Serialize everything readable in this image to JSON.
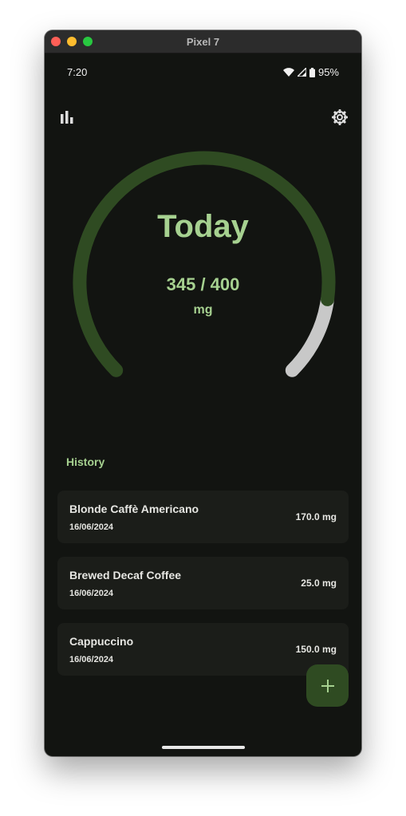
{
  "window": {
    "title": "Pixel 7"
  },
  "status_bar": {
    "time": "7:20",
    "battery": "95%"
  },
  "icons": {
    "stats": "bar-chart-icon",
    "settings": "gear-icon",
    "add": "plus-icon"
  },
  "gauge": {
    "title": "Today",
    "amount_text": "345 / 400",
    "unit": "mg",
    "consumed": 345,
    "limit": 400,
    "colors": {
      "track_fill": "#2f4b22",
      "remaining": "#c8c8c8",
      "text": "#a6d190"
    }
  },
  "history": {
    "title": "History",
    "items": [
      {
        "name": "Blonde Caffè Americano",
        "date": "16/06/2024",
        "amount": "170.0 mg"
      },
      {
        "name": "Brewed Decaf Coffee",
        "date": "16/06/2024",
        "amount": "25.0 mg"
      },
      {
        "name": "Cappuccino",
        "date": "16/06/2024",
        "amount": "150.0 mg"
      }
    ]
  }
}
